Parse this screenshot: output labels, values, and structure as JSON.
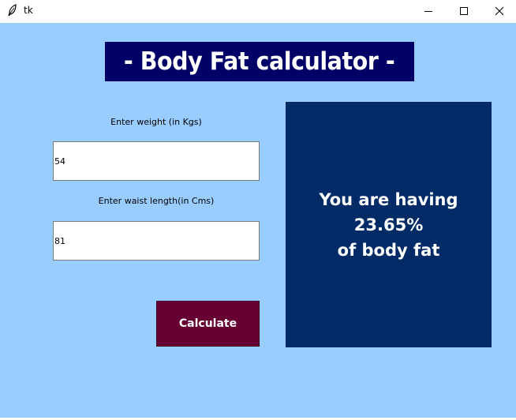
{
  "window": {
    "title": "tk"
  },
  "header": {
    "title": "- Body Fat calculator -"
  },
  "form": {
    "weight_label": "Enter weight (in Kgs)",
    "weight_value": "54",
    "waist_label": "Enter waist length(in Cms)",
    "waist_value": "81",
    "calculate_label": "Calculate"
  },
  "result": {
    "line1": "You are having 23.65%",
    "line2": "of body fat"
  },
  "colors": {
    "background": "#99ccff",
    "header_bg": "#000066",
    "button_bg": "#660033",
    "result_bg": "#002b66"
  },
  "icons": {
    "app": "feather-icon",
    "minimize": "minimize-icon",
    "maximize": "maximize-icon",
    "close": "close-icon"
  }
}
